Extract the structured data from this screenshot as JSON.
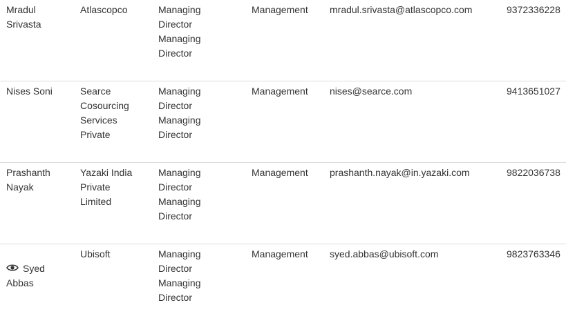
{
  "rows": [
    {
      "name_lines": [
        "Mradul",
        "Srivasta"
      ],
      "company_lines": [
        "Atlascopco"
      ],
      "title_lines": [
        "Managing",
        "Director",
        "Managing",
        "Director"
      ],
      "department": "Management",
      "email": "mradul.srivasta@atlascopco.com",
      "phone": "9372336228"
    },
    {
      "name_lines": [
        "Nises Soni"
      ],
      "company_lines": [
        "Searce",
        "Cosourcing",
        "Services",
        "Private"
      ],
      "title_lines": [
        "Managing",
        "Director",
        "Managing",
        "Director"
      ],
      "department": "Management",
      "email": "nises@searce.com",
      "phone": "9413651027"
    },
    {
      "name_lines": [
        "Prashanth",
        "Nayak"
      ],
      "company_lines": [
        "Yazaki India",
        "Private",
        "Limited"
      ],
      "title_lines": [
        "Managing",
        "Director",
        "Managing",
        "Director"
      ],
      "department": "Management",
      "email": "prashanth.nayak@in.yazaki.com",
      "phone": "9822036738"
    },
    {
      "name_lines": [
        "Syed",
        "Abbas"
      ],
      "company_lines": [
        "Ubisoft"
      ],
      "title_lines": [
        "Managing",
        "Director",
        "Managing",
        "Director"
      ],
      "department": "Management",
      "email": "syed.abbas@ubisoft.com",
      "phone": "9823763346",
      "icon": "eye-icon"
    }
  ],
  "colors": {
    "text": "#333333",
    "divider": "#dddddd",
    "background": "#ffffff"
  }
}
